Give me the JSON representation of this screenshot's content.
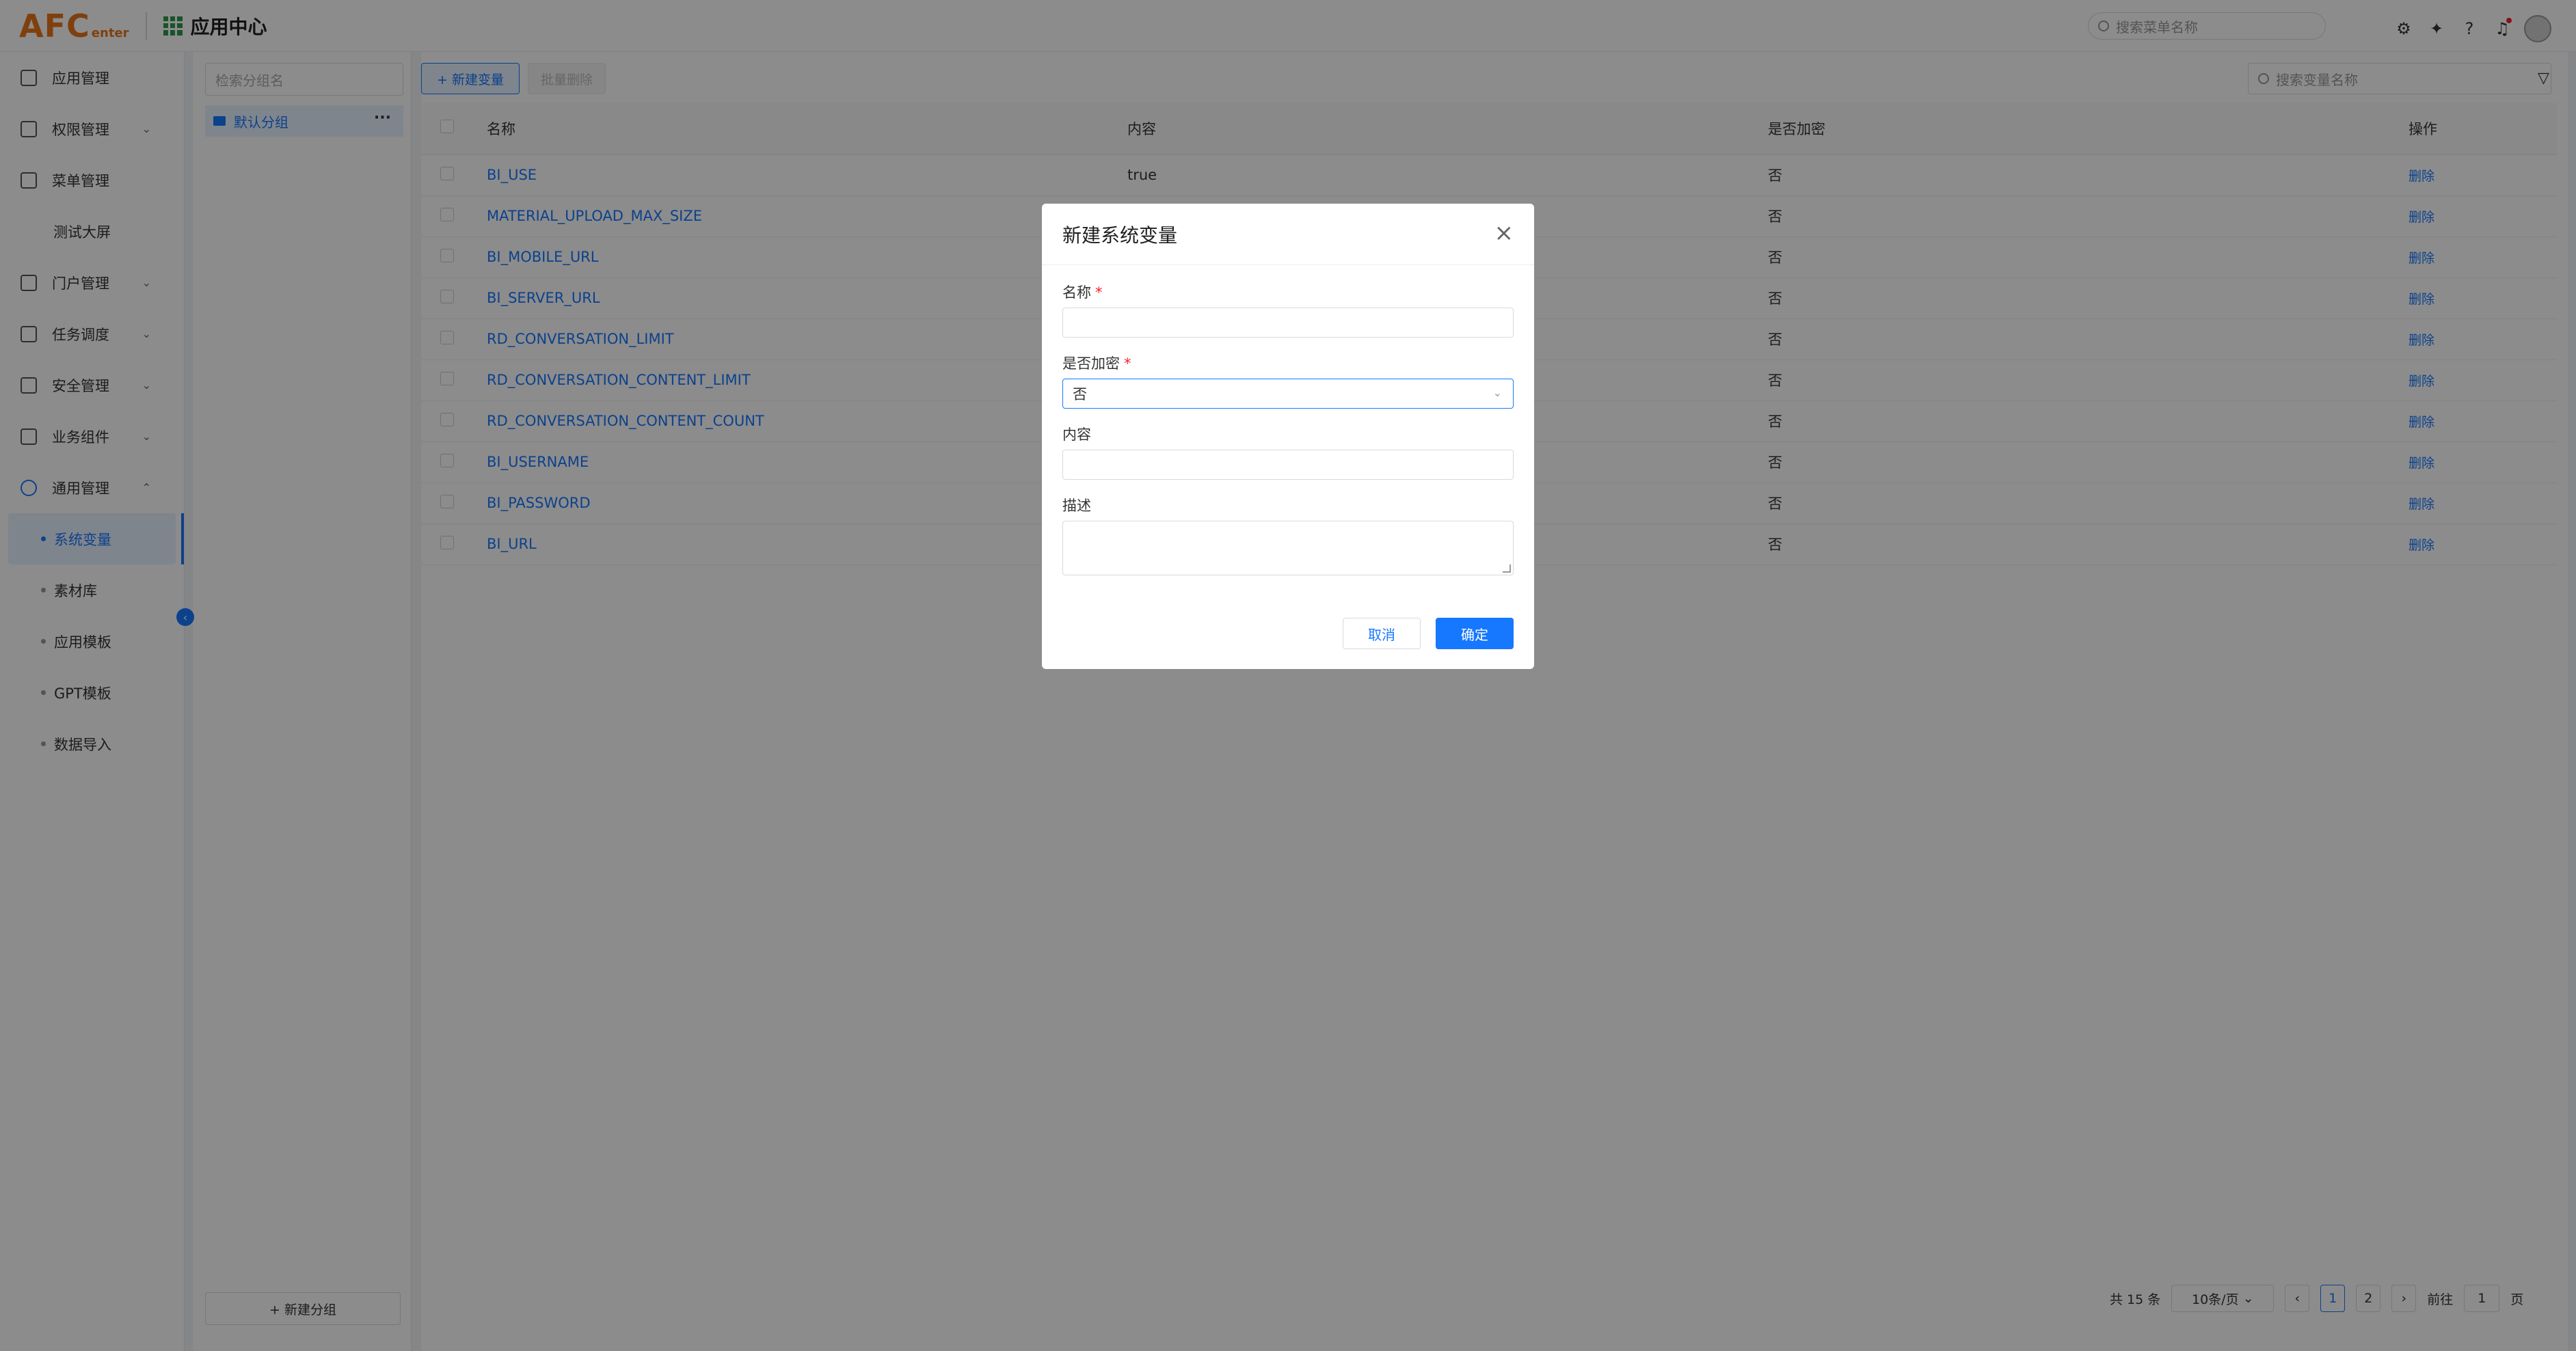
{
  "header": {
    "logo_main": "AFC",
    "logo_sub": "enter",
    "app_title": "应用中心",
    "search_placeholder": "搜索菜单名称"
  },
  "sidebar": {
    "items": [
      {
        "label": "应用管理",
        "icon": "apps-icon"
      },
      {
        "label": "权限管理",
        "icon": "user-icon"
      },
      {
        "label": "菜单管理",
        "icon": "menu-icon"
      },
      {
        "label": "测试大屏",
        "icon": ""
      },
      {
        "label": "门户管理",
        "icon": "portal-icon"
      },
      {
        "label": "任务调度",
        "icon": "task-icon"
      },
      {
        "label": "安全管理",
        "icon": "shield-icon"
      },
      {
        "label": "业务组件",
        "icon": "component-icon"
      },
      {
        "label": "通用管理",
        "icon": "settings-icon"
      }
    ],
    "sub_items": [
      {
        "label": "系统变量",
        "active": true
      },
      {
        "label": "素材库",
        "active": false
      },
      {
        "label": "应用模板",
        "active": false
      },
      {
        "label": "GPT模板",
        "active": false
      },
      {
        "label": "数据导入",
        "active": false
      }
    ]
  },
  "groups": {
    "search_placeholder": "检索分组名",
    "items": [
      {
        "label": "默认分组"
      }
    ],
    "new_group_label": "+ 新建分组"
  },
  "toolbar": {
    "new_var_label": "+ 新建变量",
    "batch_delete_label": "批量删除",
    "search_placeholder": "搜索变量名称"
  },
  "table": {
    "columns": [
      "名称",
      "内容",
      "是否加密",
      "操作"
    ],
    "rows": [
      {
        "name": "BI_USE",
        "content": "true",
        "encrypted": "否",
        "action": "删除"
      },
      {
        "name": "MATERIAL_UPLOAD_MAX_SIZE",
        "content": "",
        "encrypted": "否",
        "action": "删除"
      },
      {
        "name": "BI_MOBILE_URL",
        "content": "",
        "encrypted": "否",
        "action": "删除"
      },
      {
        "name": "BI_SERVER_URL",
        "content": "",
        "encrypted": "否",
        "action": "删除"
      },
      {
        "name": "RD_CONVERSATION_LIMIT",
        "content": "",
        "encrypted": "否",
        "action": "删除"
      },
      {
        "name": "RD_CONVERSATION_CONTENT_LIMIT",
        "content": "",
        "encrypted": "否",
        "action": "删除"
      },
      {
        "name": "RD_CONVERSATION_CONTENT_COUNT",
        "content": "",
        "encrypted": "否",
        "action": "删除"
      },
      {
        "name": "BI_USERNAME",
        "content": "",
        "encrypted": "否",
        "action": "删除"
      },
      {
        "name": "BI_PASSWORD",
        "content": "",
        "encrypted": "否",
        "action": "删除"
      },
      {
        "name": "BI_URL",
        "content": "",
        "encrypted": "否",
        "action": "删除"
      }
    ]
  },
  "pagination": {
    "total": "共 15 条",
    "page_size": "10条/页",
    "pages": [
      "1",
      "2"
    ],
    "current": "1",
    "goto_label": "前往",
    "goto_value": "1",
    "page_suffix": "页"
  },
  "modal": {
    "title": "新建系统变量",
    "name_label": "名称",
    "encrypt_label": "是否加密",
    "encrypt_value": "否",
    "content_label": "内容",
    "desc_label": "描述",
    "required_mark": "*",
    "cancel_label": "取消",
    "ok_label": "确定"
  },
  "colors": {
    "primary": "#1677ff",
    "logo": "#e8751a",
    "required": "#f5222d"
  }
}
